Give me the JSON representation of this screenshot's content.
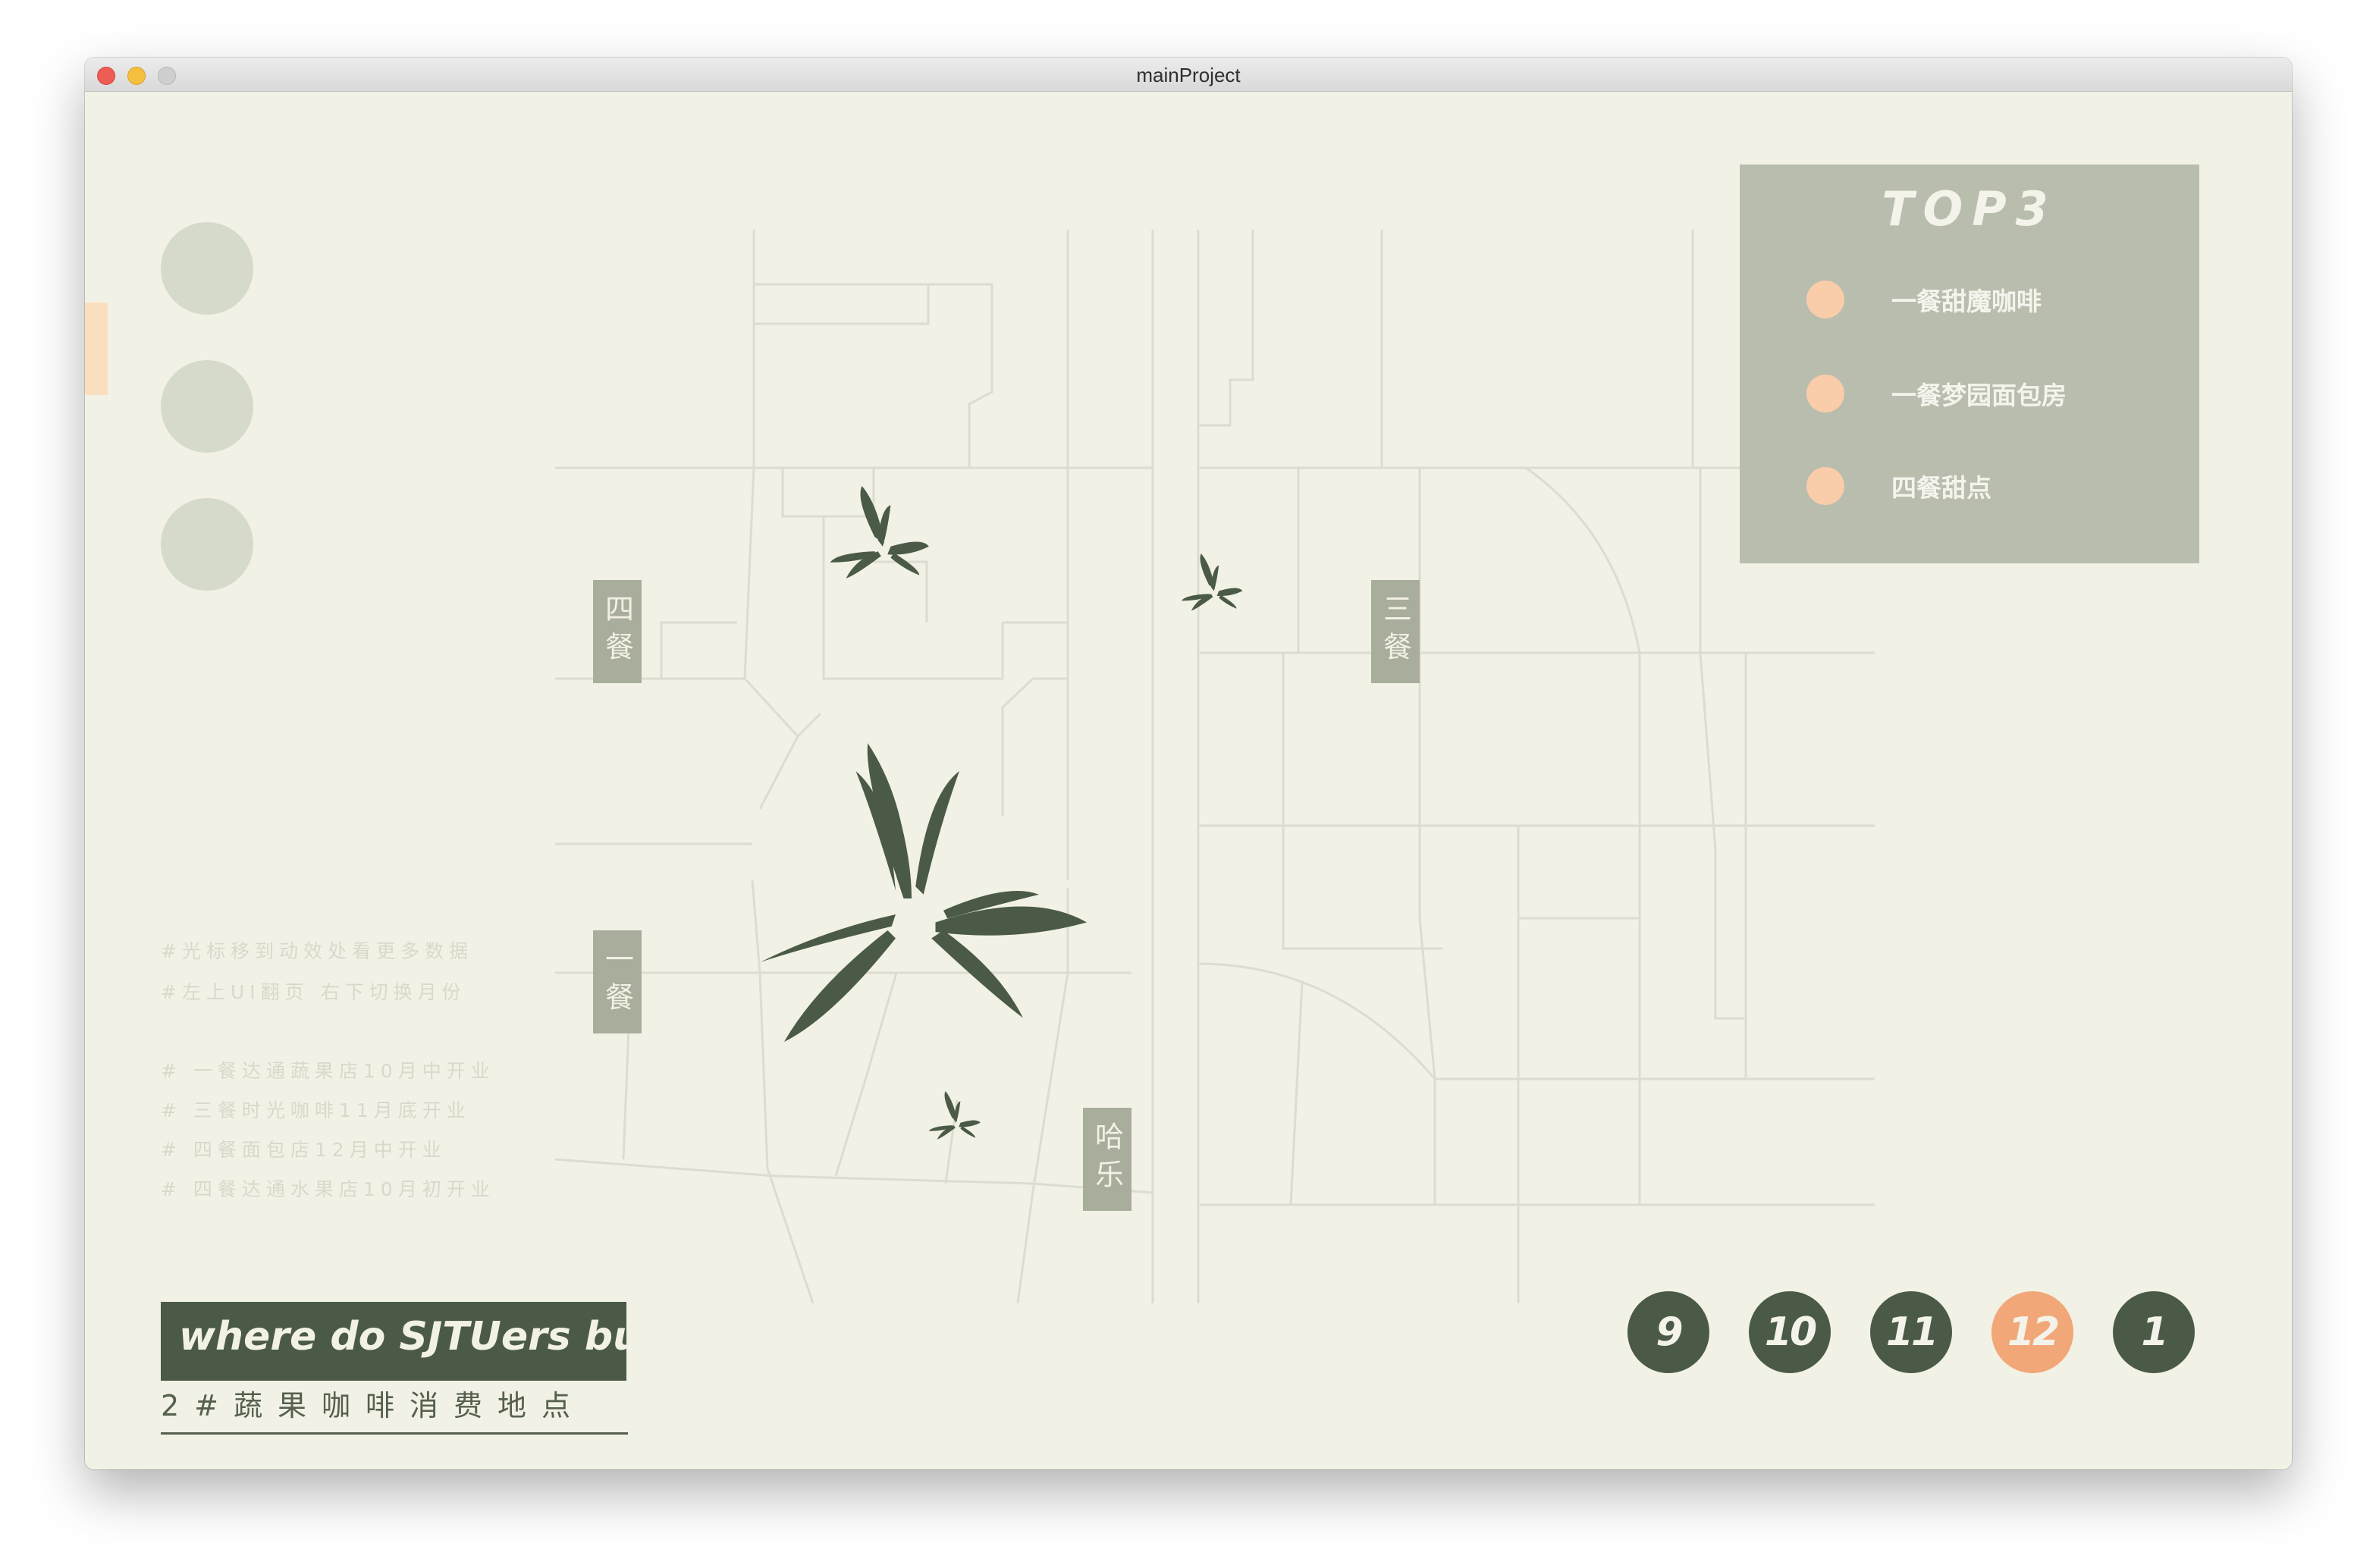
{
  "window": {
    "title": "mainProject"
  },
  "canteens": {
    "si": "四餐",
    "san": "三餐",
    "yi": "一餐",
    "hale": "哈乐"
  },
  "top3": {
    "title": "TOP3",
    "items": [
      "一餐甜魔咖啡",
      "一餐梦园面包房",
      "四餐甜点"
    ]
  },
  "notes": {
    "hints": [
      "#光标移到动效处看更多数据",
      "#左上UI翻页 右下切换月份"
    ],
    "openings": [
      "# 一餐达通蔬果店10月中开业",
      "# 三餐时光咖啡11月底开业",
      "# 四餐面包店12月中开业",
      "# 四餐达通水果店10月初开业"
    ]
  },
  "brand": {
    "title": "where do SJTUers buy",
    "subtitle": "2#蔬果咖啡消费地点"
  },
  "months": {
    "items": [
      "9",
      "10",
      "11",
      "12",
      "1"
    ],
    "active": "12"
  },
  "colors": {
    "background": "#f1f1e5",
    "dark_green": "#4b5a46",
    "accent_orange": "#f2a779",
    "peach": "#f9ccaa",
    "panel_gray": "#b9bdad"
  }
}
